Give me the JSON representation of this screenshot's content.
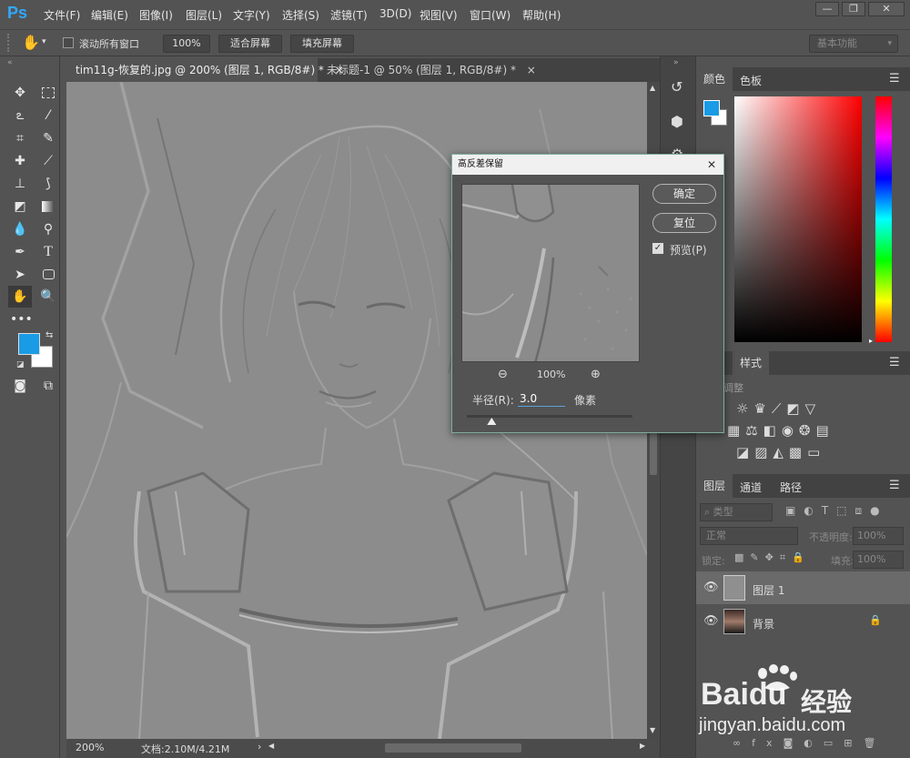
{
  "app": {
    "logo": "Ps"
  },
  "menu": {
    "items": [
      "文件(F)",
      "编辑(E)",
      "图像(I)",
      "图层(L)",
      "文字(Y)",
      "选择(S)",
      "滤镜(T)",
      "3D(D)",
      "视图(V)",
      "窗口(W)",
      "帮助(H)"
    ]
  },
  "window_controls": {
    "minimize": "—",
    "restore": "❐",
    "close": "✕"
  },
  "options": {
    "scroll_all_label": "滚动所有窗口",
    "zoom_value": "100%",
    "fit_screen": "适合屏幕",
    "fill_screen": "填充屏幕",
    "workspace": "基本功能"
  },
  "tabs": [
    {
      "label": "tim11g-恢复的.jpg @ 200% (图层 1, RGB/8#) *",
      "close": "×"
    },
    {
      "label": "未标题-1 @ 50% (图层 1, RGB/8#) *",
      "close": "×"
    }
  ],
  "status": {
    "zoom": "200%",
    "doc": "文档:2.10M/4.21M",
    "arrow": "›"
  },
  "panels": {
    "color_tab": "颜色",
    "swatches_tab": "色板",
    "styles_tab": "样式",
    "adjust_label": "调整",
    "layers_tab": "图层",
    "channels_tab": "通道",
    "paths_tab": "路径",
    "kind_filter": "类型",
    "blend_mode": "正常",
    "opacity_label": "不透明度:",
    "opacity_value": "100%",
    "lock_label": "锁定:",
    "fill_label": "填充:",
    "fill_value": "100%"
  },
  "layers": [
    {
      "name": "图层 1",
      "selected": true,
      "locked": false
    },
    {
      "name": "背景",
      "selected": false,
      "locked": true
    }
  ],
  "colors": {
    "foreground": "#1a9be5",
    "background": "#ffffff"
  },
  "dialog": {
    "title": "高反差保留",
    "ok": "确定",
    "reset": "复位",
    "preview_label": "预览(P)",
    "preview_checked": true,
    "zoom": "100%",
    "radius_label": "半径(R):",
    "radius_value": "3.0",
    "unit": "像素",
    "radius_slider_fraction": 0.15
  },
  "watermark": {
    "brand": "Baidu",
    "cn": "经验",
    "url": "jingyan.baidu.com"
  }
}
